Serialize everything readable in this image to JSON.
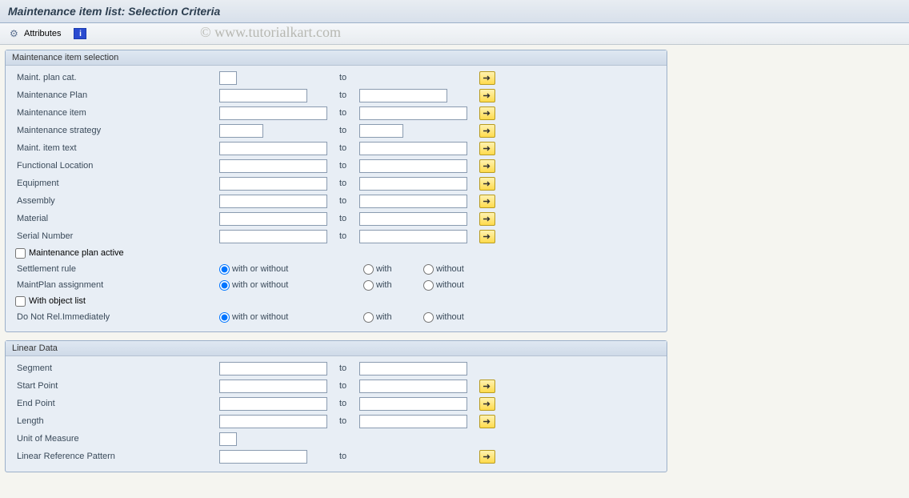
{
  "title": "Maintenance item list: Selection Criteria",
  "toolbar": {
    "attributes_label": "Attributes"
  },
  "watermark": "© www.tutorialkart.com",
  "labels": {
    "to": "to"
  },
  "group1": {
    "title": "Maintenance item selection",
    "rows": {
      "maint_plan_cat": "Maint. plan cat.",
      "maintenance_plan": "Maintenance Plan",
      "maintenance_item": "Maintenance item",
      "maintenance_strategy": "Maintenance strategy",
      "maint_item_text": "Maint. item text",
      "functional_location": "Functional Location",
      "equipment": "Equipment",
      "assembly": "Assembly",
      "material": "Material",
      "serial_number": "Serial Number"
    },
    "checkboxes": {
      "maint_plan_active": "Maintenance plan active",
      "with_object_list": "With object list"
    },
    "radio_rows": {
      "settlement_rule": "Settlement rule",
      "maintplan_assignment": "MaintPlan assignment",
      "do_not_rel": "Do Not Rel.Immediately"
    },
    "radio_opts": {
      "with_or_without": "with or without",
      "with": "with",
      "without": "without"
    }
  },
  "group2": {
    "title": "Linear Data",
    "rows": {
      "segment": "Segment",
      "start_point": "Start Point",
      "end_point": "End Point",
      "length": "Length",
      "unit_of_measure": "Unit of Measure",
      "linear_ref_pattern": "Linear Reference Pattern"
    }
  }
}
